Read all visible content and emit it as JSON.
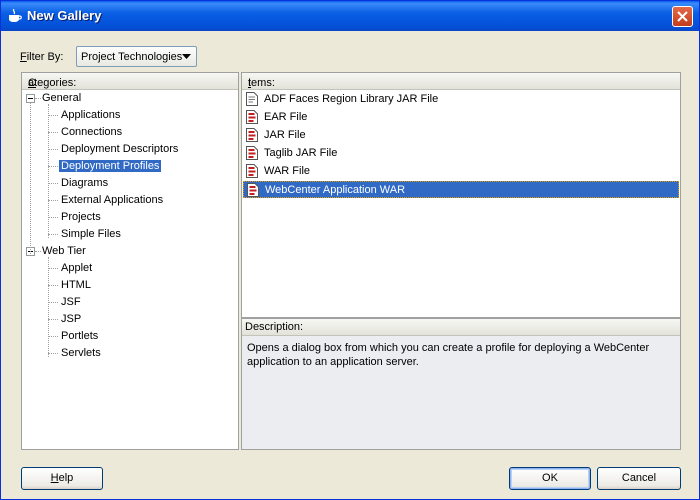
{
  "window": {
    "title": "New Gallery"
  },
  "filter": {
    "label_prefix": "F",
    "label_rest": "ilter By:",
    "value": "Project Technologies"
  },
  "categories": {
    "header_prefix": "C",
    "header_rest": "ategories:",
    "groups": [
      {
        "label": "General",
        "items": [
          "Applications",
          "Connections",
          "Deployment Descriptors",
          "Deployment Profiles",
          "Diagrams",
          "External Applications",
          "Projects",
          "Simple Files"
        ]
      },
      {
        "label": "Web Tier",
        "items": [
          "Applet",
          "HTML",
          "JSF",
          "JSP",
          "Portlets",
          "Servlets"
        ]
      }
    ],
    "selected": "Deployment Profiles"
  },
  "items": {
    "header_prefix": "I",
    "header_rest": "tems:",
    "list": [
      "ADF Faces Region Library JAR File",
      "EAR File",
      "JAR File",
      "Taglib JAR File",
      "WAR File",
      "WebCenter Application WAR"
    ],
    "selected": "WebCenter Application WAR"
  },
  "description": {
    "header": "Description:",
    "text": "Opens a dialog box from which you can create a profile for deploying a WebCenter application to an application server."
  },
  "buttons": {
    "help_prefix": "H",
    "help_rest": "elp",
    "ok": "OK",
    "cancel": "Cancel"
  }
}
